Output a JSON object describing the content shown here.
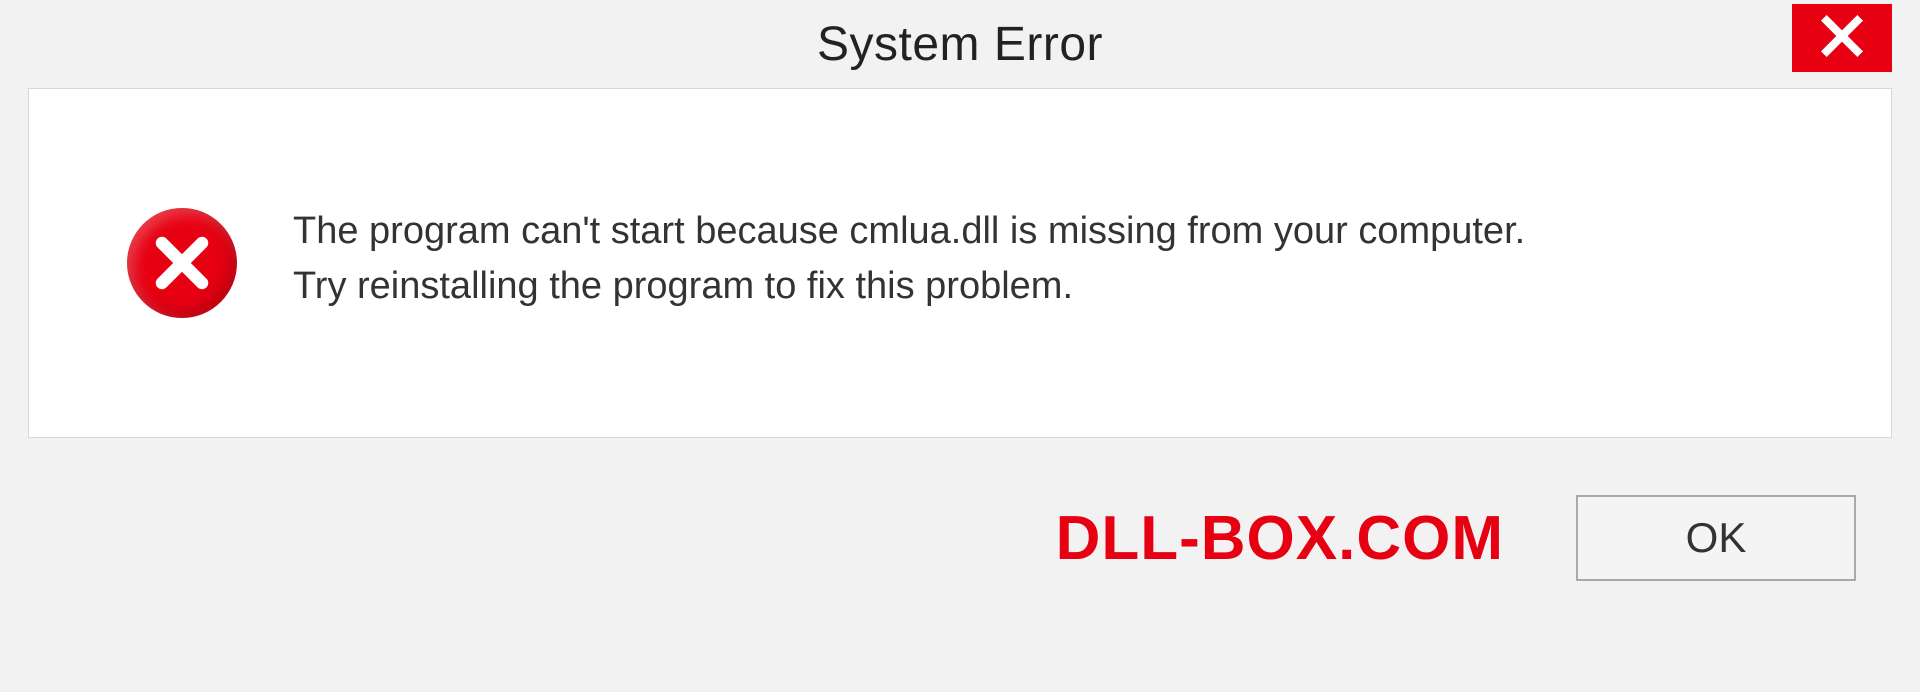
{
  "titlebar": {
    "title": "System Error"
  },
  "message": {
    "line1": "The program can't start because cmlua.dll is missing from your computer.",
    "line2": "Try reinstalling the program to fix this problem."
  },
  "footer": {
    "watermark": "DLL-BOX.COM",
    "ok_label": "OK"
  },
  "colors": {
    "accent": "#e60012"
  }
}
